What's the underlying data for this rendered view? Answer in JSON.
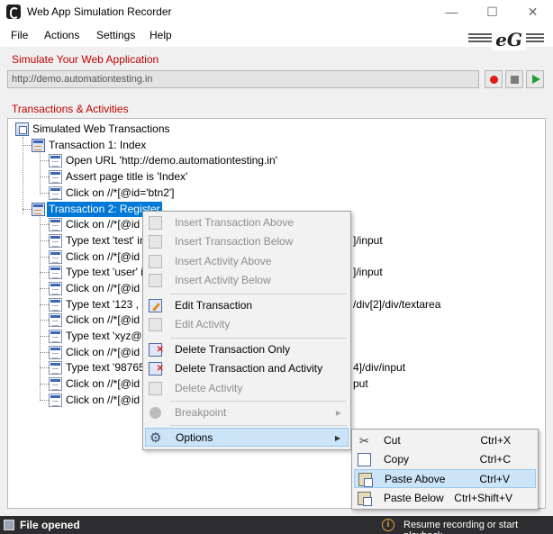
{
  "window": {
    "title": "Web App Simulation Recorder",
    "minimize": "—",
    "maximize": "☐",
    "close": "✕"
  },
  "menu": [
    "File",
    "Actions",
    "Settings",
    "Help"
  ],
  "logo_text": "eG",
  "simulate_section": {
    "label": "Simulate Your Web Application",
    "url": "http://demo.automationtesting.in"
  },
  "transactions_section": {
    "label": "Transactions & Activities"
  },
  "tree": {
    "root": "Simulated Web Transactions",
    "transactions": [
      {
        "label": "Transaction 1: Index",
        "activities": [
          "Open URL 'http://demo.automationtesting.in'",
          "Assert page title is 'Index'",
          "Click on //*[@id='btn2']"
        ]
      },
      {
        "label": "Transaction 2: Register",
        "activities": [
          "Click on //*[@id",
          "Type text 'test' in",
          "Click on //*[@id",
          "Type text 'user' in",
          "Click on //*[@id",
          "Type text '123 , a",
          "Click on //*[@id",
          "Type text 'xyz@1",
          "Click on //*[@id",
          "Type text '98765",
          "Click on //*[@id",
          "Click on //*[@id"
        ],
        "activity_tails": [
          "",
          "]/input",
          "",
          "]/input",
          "",
          "/div[2]/div/textarea",
          "",
          "",
          "",
          "4]/div/input",
          "put",
          ""
        ]
      }
    ]
  },
  "context_menu": {
    "items": [
      {
        "label": "Insert Transaction Above",
        "enabled": false,
        "icon": "insert-above-icon"
      },
      {
        "label": "Insert Transaction Below",
        "enabled": false,
        "icon": "insert-below-icon"
      },
      {
        "label": "Insert Activity Above",
        "enabled": false,
        "icon": "insert-activity-above-icon"
      },
      {
        "label": "Insert Activity Below",
        "enabled": false,
        "icon": "insert-activity-below-icon"
      },
      {
        "label": "Edit Transaction",
        "enabled": true,
        "icon": "edit-icon"
      },
      {
        "label": "Edit Activity",
        "enabled": false,
        "icon": "edit-activity-icon"
      },
      {
        "label": "Delete Transaction Only",
        "enabled": true,
        "icon": "delete-icon"
      },
      {
        "label": "Delete Transaction and Activity",
        "enabled": true,
        "icon": "delete-all-icon"
      },
      {
        "label": "Delete Activity",
        "enabled": false,
        "icon": "delete-activity-icon"
      },
      {
        "label": "Breakpoint",
        "enabled": false,
        "icon": "breakpoint-icon"
      },
      {
        "label": "Options",
        "enabled": true,
        "icon": "gear-icon"
      }
    ]
  },
  "options_submenu": {
    "items": [
      {
        "label": "Cut",
        "shortcut": "Ctrl+X",
        "icon": "scissors-icon"
      },
      {
        "label": "Copy",
        "shortcut": "Ctrl+C",
        "icon": "copy-icon"
      },
      {
        "label": "Paste Above",
        "shortcut": "Ctrl+V",
        "icon": "paste-icon"
      },
      {
        "label": "Paste Below",
        "shortcut": "Ctrl+Shift+V",
        "icon": "paste-below-icon"
      }
    ]
  },
  "status": {
    "left": "File opened",
    "right": "Resume recording or start playback"
  }
}
